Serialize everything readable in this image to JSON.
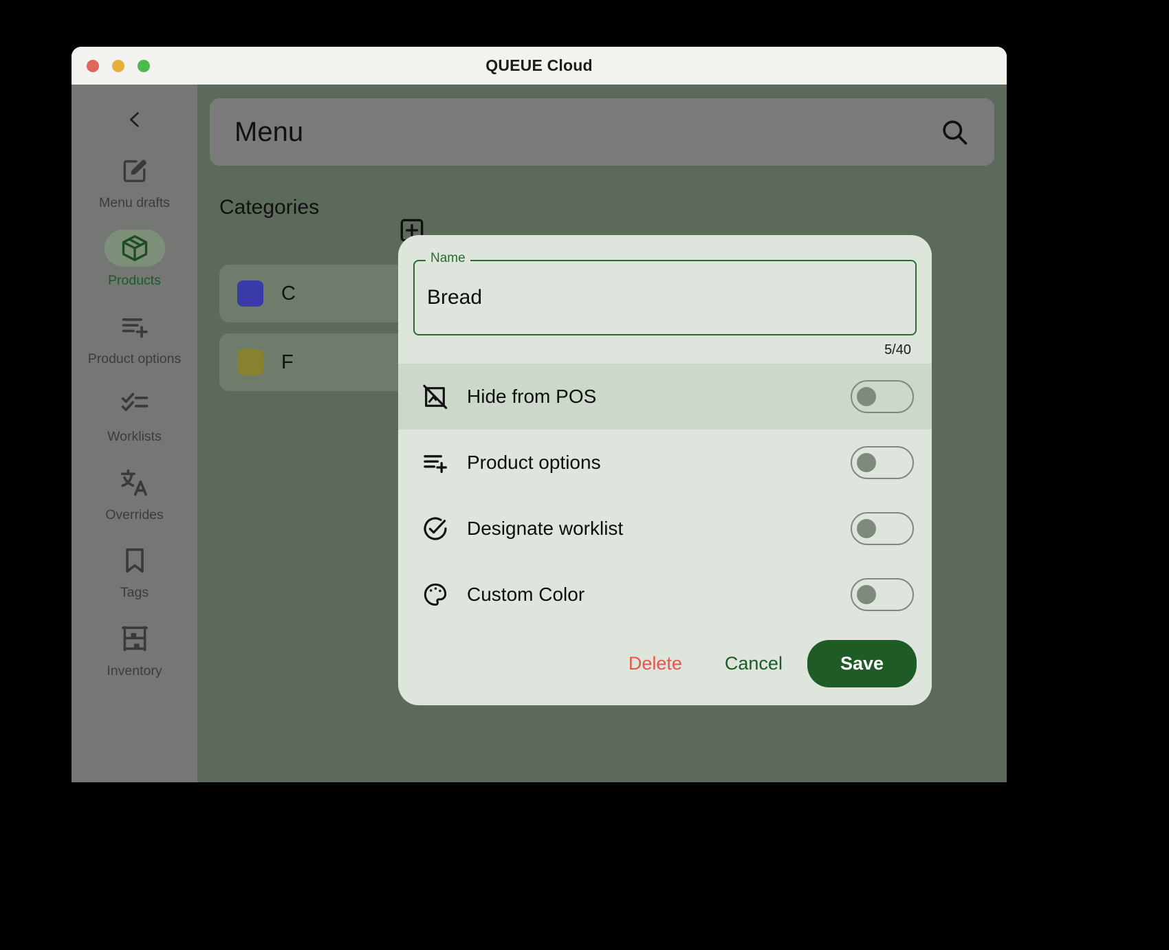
{
  "window": {
    "title": "QUEUE Cloud",
    "traffic_lights": [
      "close",
      "minimize",
      "maximize"
    ]
  },
  "sidebar": {
    "back_icon": "chevron-left-icon",
    "items": [
      {
        "label": "Menu drafts",
        "icon": "edit-note-icon",
        "active": false
      },
      {
        "label": "Products",
        "icon": "package-icon",
        "active": true
      },
      {
        "label": "Product options",
        "icon": "list-plus-icon",
        "active": false
      },
      {
        "label": "Worklists",
        "icon": "checklist-icon",
        "active": false
      },
      {
        "label": "Overrides",
        "icon": "translate-icon",
        "active": false
      },
      {
        "label": "Tags",
        "icon": "bookmark-icon",
        "active": false
      },
      {
        "label": "Inventory",
        "icon": "shelves-icon",
        "active": false
      }
    ]
  },
  "main": {
    "search_title": "Menu",
    "search_icon": "search-icon",
    "categories_label": "Categories",
    "add_category_icon": "add-box-icon",
    "categories": [
      {
        "name": "C",
        "color": "#3a3aa8"
      },
      {
        "name": "F",
        "color": "#8a8231"
      }
    ]
  },
  "dialog": {
    "name_label": "Name",
    "name_value": "Bread",
    "name_placeholder": "Name",
    "char_counter": "5/40",
    "rows": [
      {
        "label": "Hide from POS",
        "icon": "hide-image-icon",
        "enabled": false,
        "hovered": true
      },
      {
        "label": "Product options",
        "icon": "list-plus-icon",
        "enabled": false,
        "hovered": false
      },
      {
        "label": "Designate worklist",
        "icon": "check-circle-icon",
        "enabled": false,
        "hovered": false
      },
      {
        "label": "Custom Color",
        "icon": "palette-icon",
        "enabled": false,
        "hovered": false
      }
    ],
    "delete_label": "Delete",
    "cancel_label": "Cancel",
    "save_label": "Save"
  },
  "colors": {
    "accent_green": "#1e5b25",
    "field_green": "#2d6b2f",
    "delete_red": "#e4574b",
    "dialog_bg": "#dde5dc",
    "row_hover": "#ccd8c9",
    "sidebar_bg": "#757775",
    "content_bg": "#5b6a5b"
  }
}
